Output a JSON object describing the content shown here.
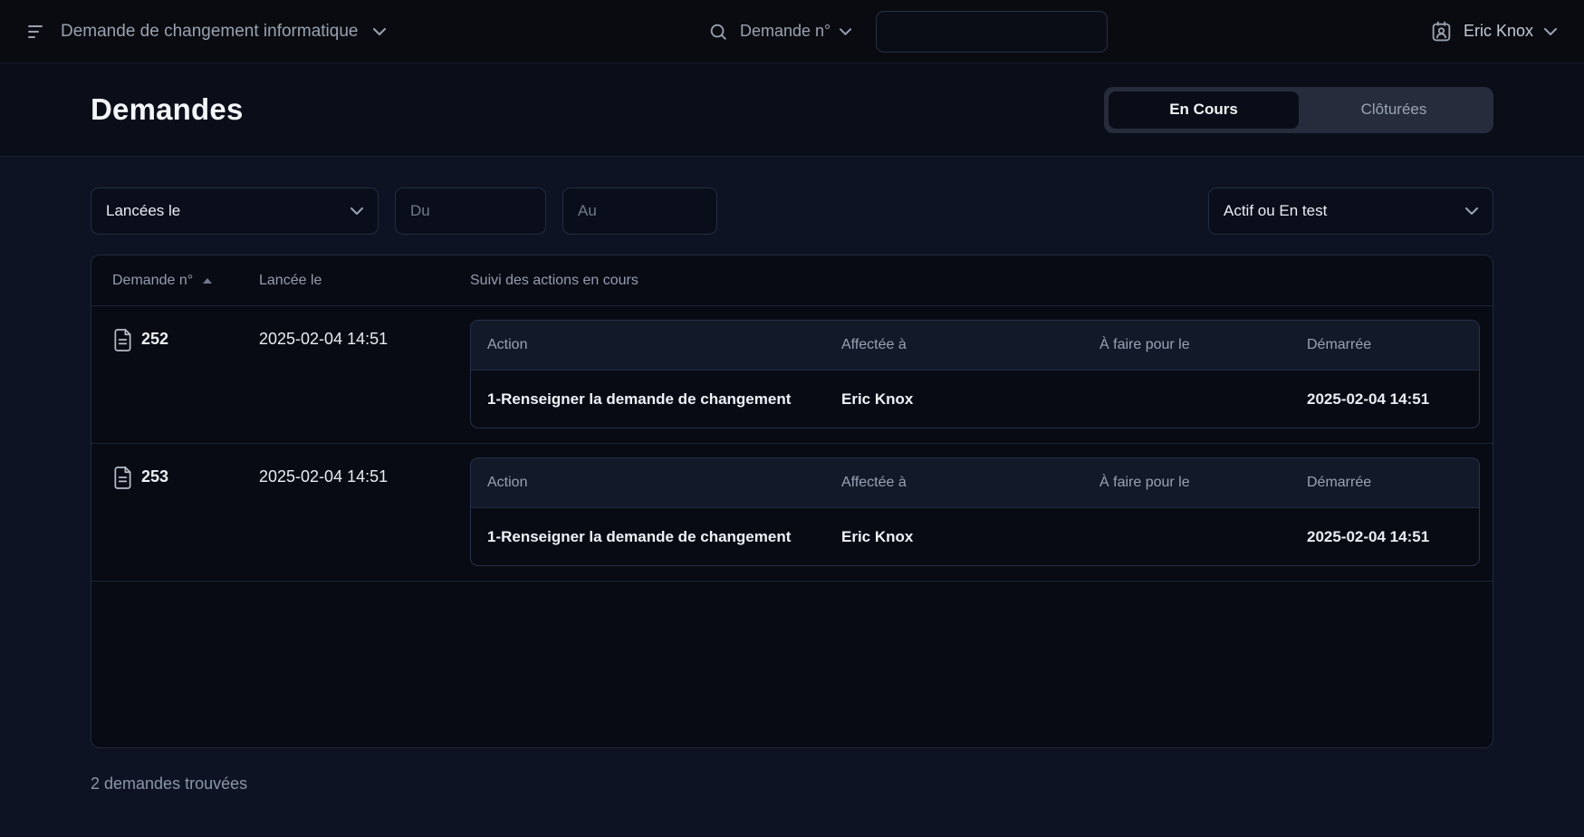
{
  "topbar": {
    "app_selector": {
      "label": "Demande de changement informatique"
    },
    "search": {
      "field_label": "Demande n°",
      "value": ""
    },
    "user": {
      "name": "Eric Knox"
    }
  },
  "page": {
    "title": "Demandes",
    "tabs": {
      "in_progress": "En Cours",
      "closed": "Clôturées"
    },
    "results_count": "2 demandes trouvées"
  },
  "filters": {
    "date_type": {
      "selected": "Lancées le"
    },
    "date_from": {
      "placeholder": "Du",
      "value": ""
    },
    "date_to": {
      "placeholder": "Au",
      "value": ""
    },
    "status": {
      "selected": "Actif ou En test"
    }
  },
  "table": {
    "columns": {
      "number": "Demande n°",
      "launched": "Lancée le",
      "actions": "Suivi des actions en cours"
    },
    "action_columns": {
      "action": "Action",
      "assignee": "Affectée à",
      "due": "À faire pour le",
      "started": "Démarrée"
    },
    "rows": [
      {
        "number": "252",
        "launched": "2025-02-04 14:51",
        "actions": [
          {
            "action": "1-Renseigner la demande de changement",
            "assignee": "Eric Knox",
            "due": "",
            "started": "2025-02-04 14:51"
          }
        ]
      },
      {
        "number": "253",
        "launched": "2025-02-04 14:51",
        "actions": [
          {
            "action": "1-Renseigner la demande de changement",
            "assignee": "Eric Knox",
            "due": "",
            "started": "2025-02-04 14:51"
          }
        ]
      }
    ]
  },
  "colors": {
    "topbar_bg": "#090b10",
    "header_bg": "#0a0e19",
    "main_bg": "#0d1322",
    "card_bg": "#080b13",
    "active_tab_bg": "#0a0d17",
    "segmented_bg": "#262c3c",
    "primary_text": "#eef1f6",
    "muted_text": "#939cb0"
  }
}
